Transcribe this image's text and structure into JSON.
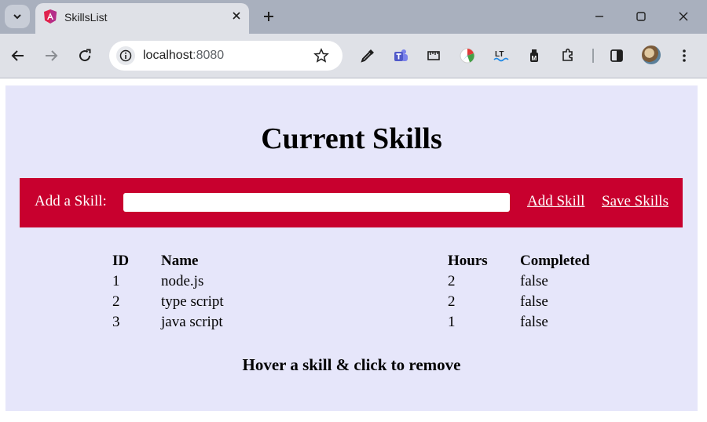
{
  "browser": {
    "tab": {
      "title": "SkillsList"
    },
    "address": {
      "host": "localhost",
      "port": ":8080"
    },
    "colors": {
      "tabstrip": "#a9b0be",
      "toolbar": "#dfe1e7"
    }
  },
  "page": {
    "title": "Current Skills",
    "add_bar": {
      "label": "Add a Skill:",
      "input_value": "",
      "add_button": "Add Skill",
      "save_button": "Save Skills",
      "color": "#c8002e"
    },
    "table": {
      "headers": [
        "ID",
        "Name",
        "Hours",
        "Completed"
      ],
      "rows": [
        [
          "1",
          "node.js",
          "2",
          "false"
        ],
        [
          "2",
          "type script",
          "2",
          "false"
        ],
        [
          "3",
          "java script",
          "1",
          "false"
        ]
      ]
    },
    "footer": "Hover a skill & click to remove",
    "background": "#e6e6fa"
  }
}
